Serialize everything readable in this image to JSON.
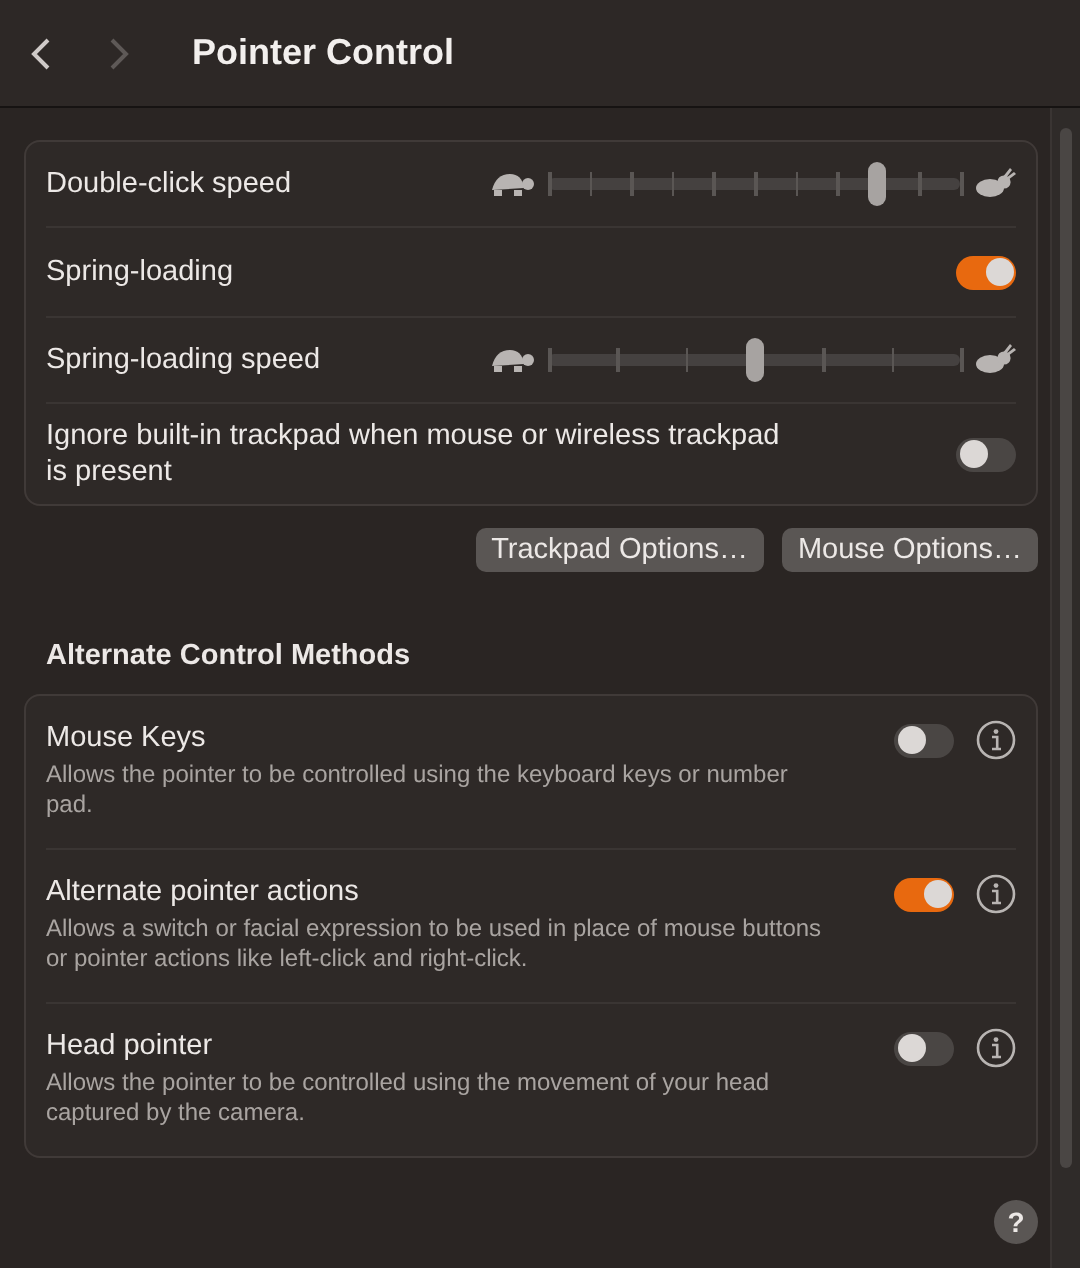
{
  "window": {
    "title": "Pointer Control"
  },
  "trackpad_settings": [
    {
      "kind": "slider",
      "label": "Double-click speed",
      "level": 0.8
    },
    {
      "kind": "toggle",
      "label": "Spring-loading",
      "on": true
    },
    {
      "kind": "slider",
      "label": "Spring-loading speed",
      "level": 0.5
    },
    {
      "kind": "toggle",
      "label": "Ignore built-in trackpad when mouse or wireless trackpad is present",
      "on": false
    }
  ],
  "buttons": [
    "Trackpad Options…",
    "Mouse Options…"
  ],
  "alternate_section": {
    "title": "Alternate Control Methods",
    "items": [
      {
        "label": "Mouse Keys",
        "description": "Allows the pointer to be controlled using the keyboard keys or number pad.",
        "on": false
      },
      {
        "label": "Alternate pointer actions",
        "description": "Allows a switch or facial expression to be used in place of mouse buttons or pointer actions like left-click and right-click.",
        "on": true
      },
      {
        "label": "Head pointer",
        "description": "Allows the pointer to be controlled using the movement of your head captured by the camera.",
        "on": false
      }
    ]
  },
  "help": {
    "label": "?"
  }
}
